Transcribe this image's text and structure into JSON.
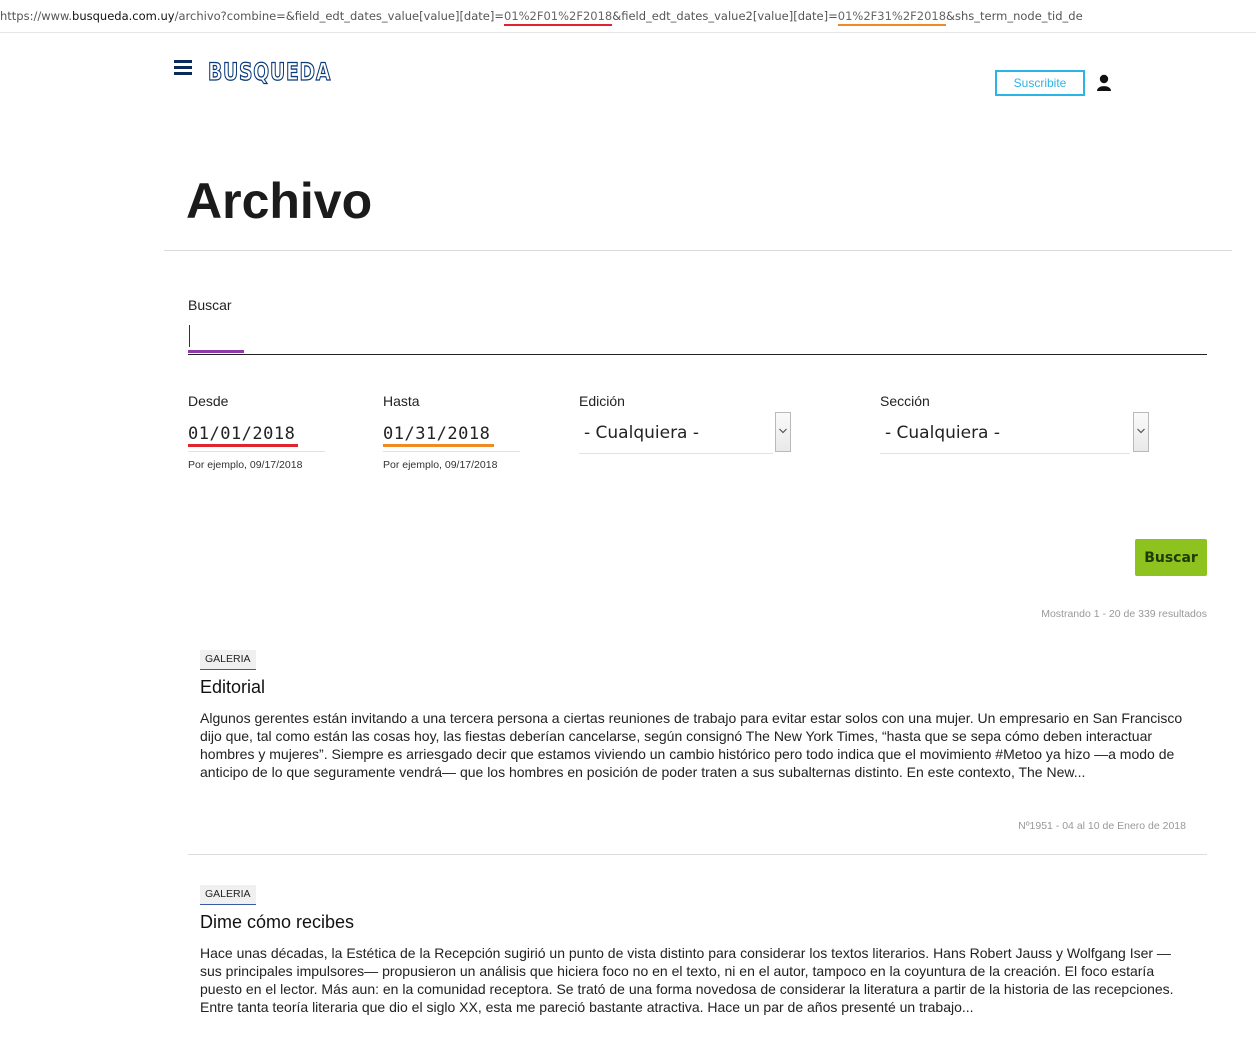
{
  "browser": {
    "url_prefix": "https://www.",
    "url_domain": "busqueda.com.uy",
    "url_path": "/archivo?combine=&field_edt_dates_value[value][date]=",
    "url_date1": "01%2F01%2F2018",
    "url_mid": "&field_edt_dates_value2[value][date]=",
    "url_date2": "01%2F31%2F2018",
    "url_tail": "&shs_term_node_tid_de"
  },
  "header": {
    "logo_text": "BUSQUEDA",
    "subscribe_label": "Suscribite"
  },
  "page": {
    "title": "Archivo"
  },
  "filters": {
    "search_label": "Buscar",
    "search_value": "",
    "from_label": "Desde",
    "from_value": "01/01/2018",
    "from_hint": "Por ejemplo, 09/17/2018",
    "to_label": "Hasta",
    "to_value": "01/31/2018",
    "to_hint": "Por ejemplo, 09/17/2018",
    "edition_label": "Edición",
    "edition_value": "- Cualquiera -",
    "section_label": "Sección",
    "section_value": "- Cualquiera -",
    "submit_label": "Buscar"
  },
  "results": {
    "count_text": "Mostrando 1 - 20 de 339 resultados",
    "items": [
      {
        "category": "GALERIA",
        "title": "Editorial",
        "excerpt": "Algunos gerentes están invitando a una tercera persona a ciertas reuniones de trabajo para evitar estar solos con una mujer. Un empresario en San Francisco dijo que, tal como están las cosas hoy, las fiestas deberían cancelarse, según consignó The New York Times, “hasta que se sepa cómo deben interactuar hombres y mujeres”.  Siempre es arriesgado decir que estamos viviendo un cambio histórico pero todo indica que el movimiento #Metoo ya hizo —a modo de anticipo de lo que seguramente vendrá— que los hombres en posición de poder traten a sus subalternas distinto.  En este contexto, The New...",
        "meta": "Nº1951 - 04 al 10 de Enero de 2018"
      },
      {
        "category": "GALERIA",
        "title": "Dime cómo recibes",
        "excerpt": "Hace unas décadas, la Estética de la Recepción sugirió un punto de vista distinto para considerar los textos literarios. Hans Robert Jauss y Wolfgang Iser —sus principales impulsores— propusieron un análisis que hiciera foco no en el texto, ni en el autor, tampoco en la coyuntura de la creación. El foco estaría puesto en el lector. Más aun: en la comunidad receptora. Se trató de una forma novedosa de considerar la literatura a partir de la historia de las recepciones. Entre tanta teoría literaria que dio el siglo XX, esta me pareció bastante atractiva.  Hace un par de años presenté un trabajo...",
        "meta": ""
      }
    ]
  },
  "colors": {
    "accent_green": "#8dc21f",
    "subscribe_blue": "#2bb5e6",
    "mark_red": "#e0232d",
    "mark_orange": "#f08a23",
    "mark_purple": "#8e3aa8"
  }
}
